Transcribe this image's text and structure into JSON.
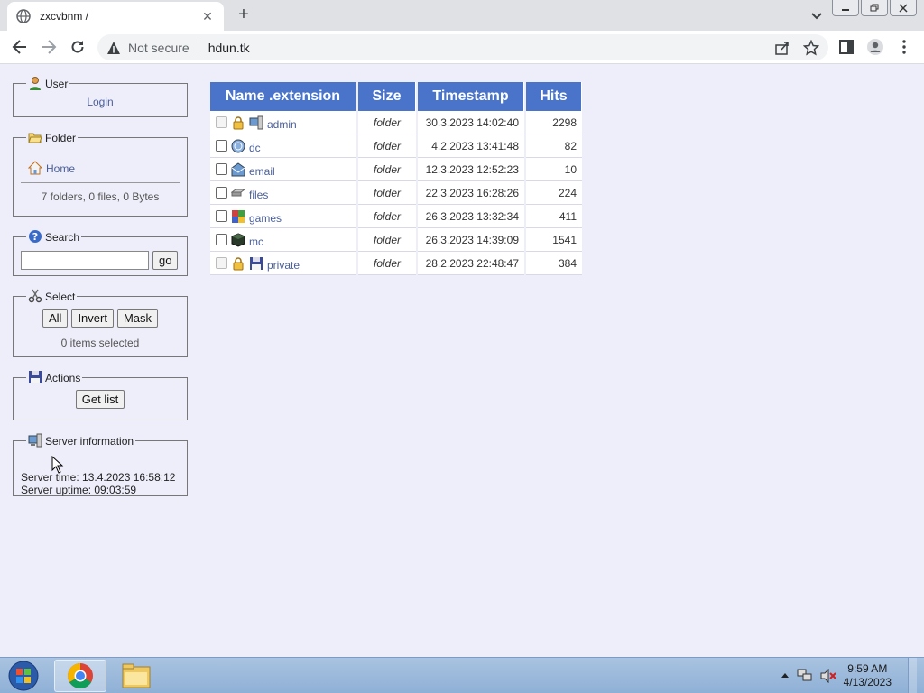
{
  "browser": {
    "tab_title": "zxcvbnm /",
    "tab_close": "✕",
    "new_tab": "+",
    "security_label": "Not secure",
    "url": "hdun.tk"
  },
  "sidebar": {
    "user": {
      "legend": "User",
      "login": "Login"
    },
    "folder": {
      "legend": "Folder",
      "home": "Home",
      "summary": "7 folders, 0 files, 0 Bytes"
    },
    "search": {
      "legend": "Search",
      "value": "",
      "go": "go"
    },
    "select": {
      "legend": "Select",
      "all": "All",
      "invert": "Invert",
      "mask": "Mask",
      "status": "0 items selected"
    },
    "actions": {
      "legend": "Actions",
      "get_list": "Get list"
    },
    "server": {
      "legend": "Server information",
      "time": "Server time: 13.4.2023 16:58:12",
      "uptime": "Server uptime: 09:03:59"
    }
  },
  "table": {
    "headers": [
      "Name .extension",
      "Size",
      "Timestamp",
      "Hits"
    ],
    "rows": [
      {
        "name": "admin",
        "size": "folder",
        "timestamp": "30.3.2023 14:02:40",
        "hits": "2298",
        "locked": true,
        "icon": "computer-icon"
      },
      {
        "name": "dc",
        "size": "folder",
        "timestamp": "4.2.2023 13:41:48",
        "hits": "82",
        "locked": false,
        "icon": "globe-icon"
      },
      {
        "name": "email",
        "size": "folder",
        "timestamp": "12.3.2023 12:52:23",
        "hits": "10",
        "locked": false,
        "icon": "mail-icon"
      },
      {
        "name": "files",
        "size": "folder",
        "timestamp": "22.3.2023 16:28:26",
        "hits": "224",
        "locked": false,
        "icon": "drive-icon"
      },
      {
        "name": "games",
        "size": "folder",
        "timestamp": "26.3.2023 13:32:34",
        "hits": "411",
        "locked": false,
        "icon": "games-icon"
      },
      {
        "name": "mc",
        "size": "folder",
        "timestamp": "26.3.2023 14:39:09",
        "hits": "1541",
        "locked": false,
        "icon": "block-icon"
      },
      {
        "name": "private",
        "size": "folder",
        "timestamp": "28.2.2023 22:48:47",
        "hits": "384",
        "locked": true,
        "icon": "floppy-icon"
      }
    ]
  },
  "taskbar": {
    "time": "9:59 AM",
    "date": "4/13/2023"
  }
}
